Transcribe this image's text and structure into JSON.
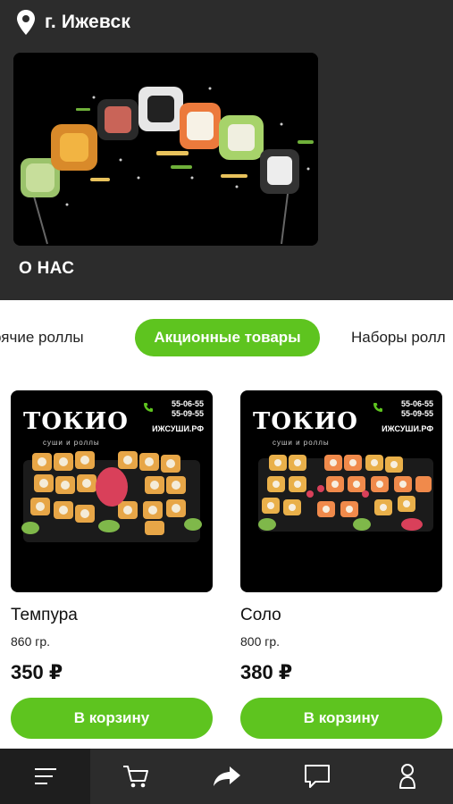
{
  "header": {
    "city": "г. Ижевск",
    "about_label": "О НАС"
  },
  "tabs": [
    {
      "label": "рячие роллы",
      "active": false
    },
    {
      "label": "Акционные товары",
      "active": true
    },
    {
      "label": "Наборы ролл",
      "active": false
    }
  ],
  "products": [
    {
      "name": "Темпура",
      "weight": "860 гр.",
      "price": "350 ₽",
      "button": "В корзину",
      "brand": "ТОКИО",
      "brand_sub": "суши и роллы",
      "phone1": "55-06-55",
      "phone2": "55-09-55",
      "site": "ИЖСУШИ.РФ"
    },
    {
      "name": "Соло",
      "weight": "800 гр.",
      "price": "380 ₽",
      "button": "В корзину",
      "brand": "ТОКИО",
      "brand_sub": "суши и роллы",
      "phone1": "55-06-55",
      "phone2": "55-09-55",
      "site": "ИЖСУШИ.РФ"
    }
  ],
  "nav": [
    {
      "icon": "menu-icon",
      "active": true
    },
    {
      "icon": "cart-icon",
      "active": false
    },
    {
      "icon": "share-icon",
      "active": false
    },
    {
      "icon": "chat-icon",
      "active": false
    },
    {
      "icon": "profile-icon",
      "active": false
    }
  ],
  "colors": {
    "accent": "#5ec41f",
    "header_bg": "#2c2c2c"
  }
}
